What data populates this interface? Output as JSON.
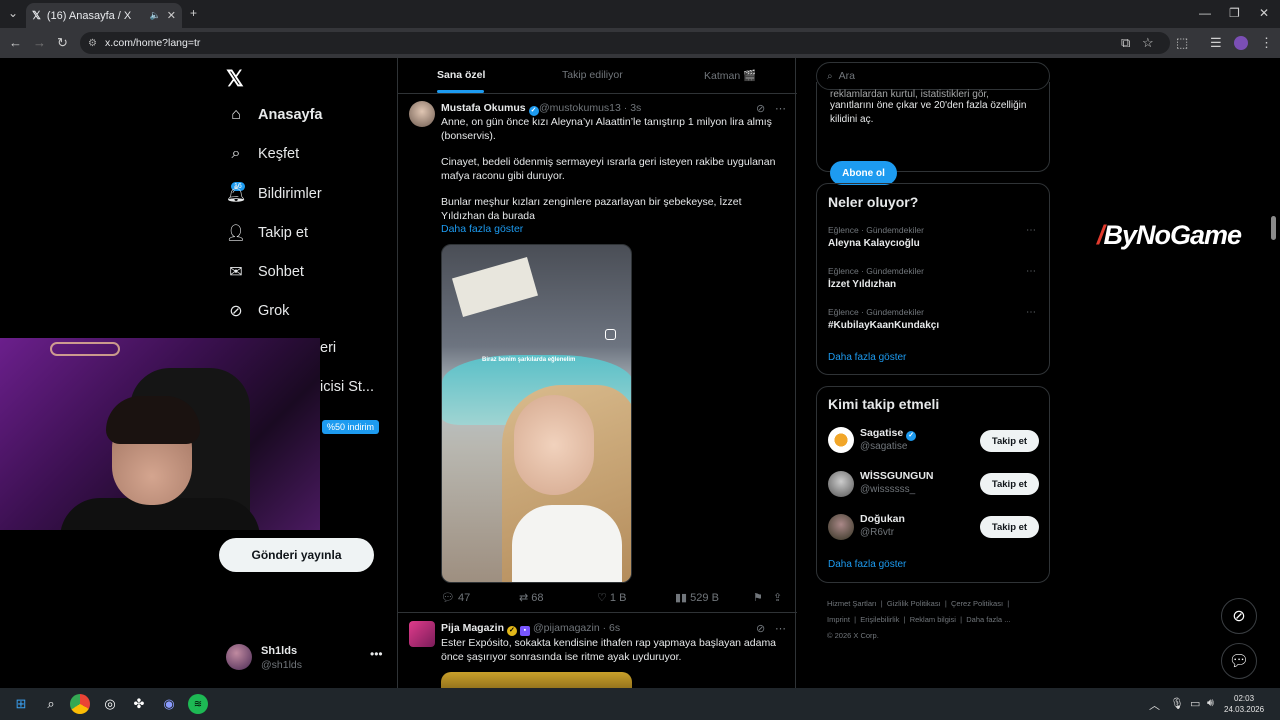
{
  "browser": {
    "tab_title": "(16) Anasayfa / X",
    "url": "x.com/home?lang=tr"
  },
  "left_nav": {
    "items": [
      {
        "label": "Anasayfa",
        "icon": "home-icon"
      },
      {
        "label": "Keşfet",
        "icon": "search-icon"
      },
      {
        "label": "Bildirimler",
        "icon": "bell-icon",
        "badge": "16"
      },
      {
        "label": "Takip et",
        "icon": "follow-icon"
      },
      {
        "label": "Sohbet",
        "icon": "mail-icon"
      },
      {
        "label": "Grok",
        "icon": "grok-icon"
      }
    ],
    "partial_items": [
      "eri",
      "icisi St..."
    ],
    "discount_badge": "%50 indirim",
    "post_button": "Gönderi yayınla",
    "profile": {
      "name": "Sh1lds",
      "handle": "@sh1lds"
    }
  },
  "feed": {
    "tabs": [
      "Sana özel",
      "Takip ediliyor",
      "Katman 🎬"
    ],
    "tweets": [
      {
        "name": "Mustafa Okumus",
        "handle": "@mustokumus13 · 3s",
        "paragraphs": [
          "Anne, on gün önce kızı Aleyna’yı Alaattin’le tanıştırıp  1 milyon lira almış (bonservis).",
          "Cinayet, bedeli ödenmiş sermayeyi ısrarla geri isteyen rakibe uygulanan mafya raconu gibi duruyor.",
          "Bunlar meşhur kızları zenginlere pazarlayan bir şebekeyse, İzzet Yıldızhan da burada"
        ],
        "show_more": "Daha fazla göster",
        "media_caption": "Biraz benim şarkılarda eğlenelim",
        "stats": {
          "replies": "47",
          "reposts": "68",
          "likes": "1 B",
          "views": "529 B"
        }
      },
      {
        "name": "Pija Magazin",
        "handle": "@pijamagazin · 6s",
        "paragraphs": [
          "Ester Expósito, sokakta kendisine ithafen rap yapmaya başlayan adama önce şaşırıyor sonrasında ise ritme ayak uyduruyor."
        ]
      }
    ]
  },
  "sidebar": {
    "search_placeholder": "Ara",
    "premium_text": "yanıtlarını öne çıkar ve 20'den fazla özelliğin kilidini aç.",
    "premium_text_partial": "reklamlardan kurtul, istatistikleri gör,",
    "subscribe_button": "Abone ol",
    "trends_title": "Neler oluyor?",
    "trends": [
      {
        "category": "Eğlence · Gündemdekiler",
        "name": "Aleyna Kalaycıoğlu"
      },
      {
        "category": "Eğlence · Gündemdekiler",
        "name": "İzzet Yıldızhan"
      },
      {
        "category": "Eğlence · Gündemdekiler",
        "name": "#KubilayKaanKundakçı"
      }
    ],
    "trends_show_more": "Daha fazla göster",
    "who_to_follow_title": "Kimi takip etmeli",
    "who_to_follow": [
      {
        "name": "Sagatise",
        "handle": "@sagatise",
        "verified": true
      },
      {
        "name": "WİSSGUNGUN",
        "handle": "@wissssss_",
        "verified": false
      },
      {
        "name": "Doğukan",
        "handle": "@R6vtr",
        "verified": false
      }
    ],
    "follow_label": "Takip et",
    "follow_show_more": "Daha fazla göster",
    "footer": [
      "Hizmet Şartları",
      "Gizlilik Politikası",
      "Çerez Politikası",
      "Imprint",
      "Erişilebilirlik",
      "Reklam bilgisi",
      "Daha fazla ...",
      "© 2026 X Corp."
    ]
  },
  "overlay": {
    "brand": "ByNoGame"
  },
  "taskbar": {
    "time": "02:03",
    "date": "24.03.2026"
  },
  "colors": {
    "accent": "#1d9bf0",
    "background": "#000000",
    "border": "#2f3336",
    "muted": "#71767b"
  }
}
